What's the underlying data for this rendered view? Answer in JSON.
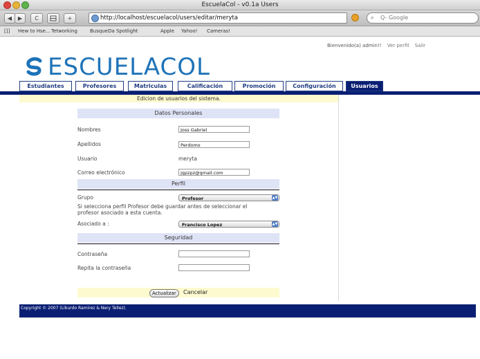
{
  "window": {
    "title": "EscuelaCol - v0.1a Users"
  },
  "browser": {
    "back": "◀",
    "forward": "▶",
    "reload": "C",
    "add": "+",
    "url": "http://localhost/escuelacol/users/editar/meryta",
    "search_placeholder": "Q- Google",
    "bookmarks": [
      "[]]",
      "Hew to Hse...",
      "Tetworking",
      "BusqueDa Spotlight",
      "Apple",
      "Yahoo!",
      "Cameras!"
    ]
  },
  "header": {
    "welcome": "Bienvenido(a) admin!!",
    "links": [
      "Ver perfil",
      "Salir"
    ],
    "brand": "ESCUELACOL"
  },
  "tabs": [
    "Estudiantes",
    "Profesores",
    "Matriculas",
    "Calificación",
    "Promoción",
    "Configuración",
    "Usuarios"
  ],
  "active_tab": "Usuarios",
  "main": {
    "banner": "Edicion de usuarios del sistema.",
    "sections": {
      "personal": "Datos Personales",
      "profile": "Perfil",
      "security": "Seguridad"
    },
    "fields": {
      "nombres": {
        "label": "Nombres",
        "value": "Joss Gabriel"
      },
      "apellidos": {
        "label": "Apellidos",
        "value": "Perdomo"
      },
      "usuario": {
        "label": "Usuario",
        "value": "meryta"
      },
      "correo": {
        "label": "Correo electrónico",
        "value": "jgpzpz@gmail.com"
      },
      "grupo": {
        "label": "Grupo",
        "value": "Profesor"
      },
      "asociado": {
        "label": "Asociado a :",
        "value": "Francisco Lopez"
      },
      "contrasena": {
        "label": "Contraseña",
        "value": ""
      },
      "repita": {
        "label": "Repita la contraseña",
        "value": ""
      }
    },
    "profile_note_1": "Si selecciona perfil Profesor debe guardar antes de seleccionar el",
    "profile_note_2": "profesor asociado a esta cuenta.",
    "actions": {
      "submit": "Actualizar",
      "cancel": "Cancelar"
    }
  },
  "footer": {
    "text": "Copyright © 2007 (Liburdo Ramirez & Nery Tellez)."
  },
  "colors": {
    "navy": "#0a1f73",
    "brand_blue": "#1e73b8",
    "section_bg": "#dfe3f6",
    "banner_bg": "#fdfacf"
  }
}
